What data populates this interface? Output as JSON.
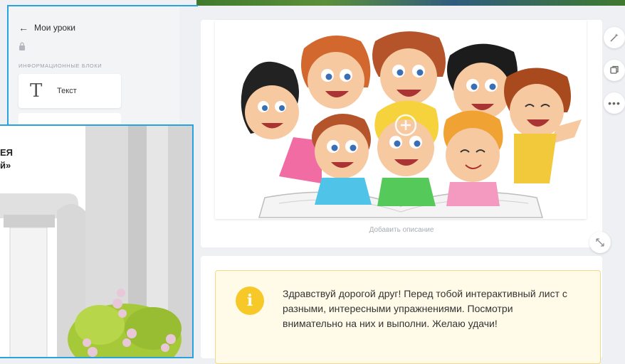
{
  "sidebar": {
    "back_label": "Мои уроки",
    "section_title": "ИНФОРМАЦИОННЫЕ БЛОКИ",
    "blocks": [
      {
        "label": "Текст",
        "icon": "text-icon"
      }
    ]
  },
  "main": {
    "description_placeholder": "Добавить описание",
    "info_text": "Здравствуй дорогой друг! Перед тобой интерактивный лист с разными, интересными упражнениями. Посмотри внимательно на них и выполни. Желаю удачи!",
    "info_icon": "i"
  },
  "tools": {
    "items": [
      "magic-wand-icon",
      "copy-icon",
      "more-icon"
    ],
    "resize": "resize-icon"
  },
  "overlay": {
    "title": "ЕЯ",
    "subtitle": "й»"
  },
  "colors": {
    "accent": "#29a3e0",
    "info_icon_bg": "#f7c928",
    "info_box_bg": "#fffbe8",
    "info_box_border": "#f1d98a"
  }
}
